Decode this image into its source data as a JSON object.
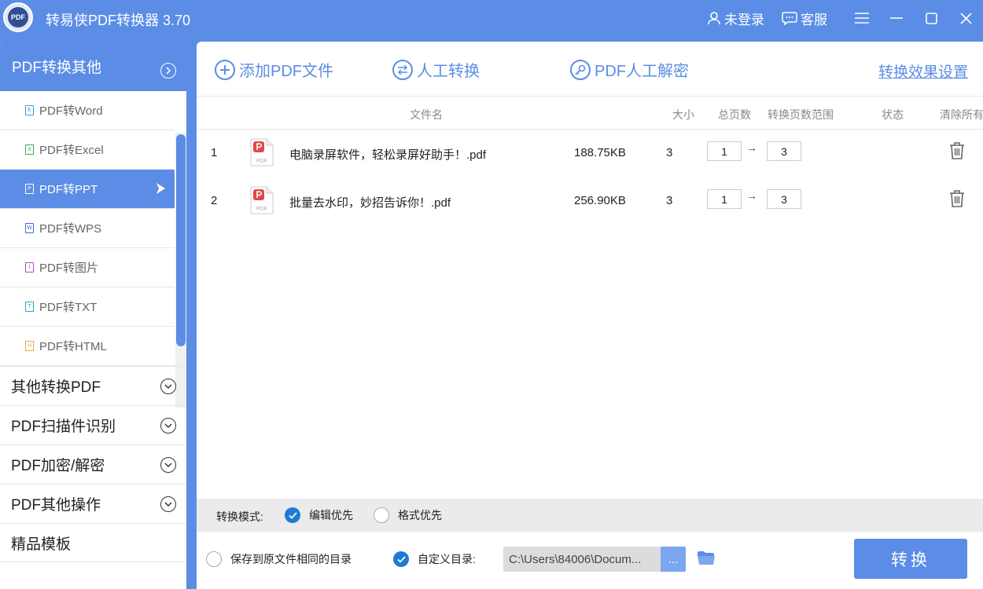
{
  "app": {
    "title": "转易侠PDF转换器 3.70",
    "logo_text": "PDF"
  },
  "titlebar": {
    "login_label": "未登录",
    "service_label": "客服"
  },
  "sidebar": {
    "header": "PDF转换其他",
    "sub_items": [
      {
        "label": "PDF转Word",
        "icon": "word-file-icon",
        "color": "#3a9ad9",
        "glyph": "E"
      },
      {
        "label": "PDF转Excel",
        "icon": "excel-file-icon",
        "color": "#3aa655",
        "glyph": "X"
      },
      {
        "label": "PDF转PPT",
        "icon": "ppt-file-icon",
        "color": "#ffffff",
        "glyph": "P"
      },
      {
        "label": "PDF转WPS",
        "icon": "wps-file-icon",
        "color": "#3a6fd9",
        "glyph": "W"
      },
      {
        "label": "PDF转图片",
        "icon": "image-file-icon",
        "color": "#b04ad0",
        "glyph": "I"
      },
      {
        "label": "PDF转TXT",
        "icon": "txt-file-icon",
        "color": "#2aa5c8",
        "glyph": "T"
      },
      {
        "label": "PDF转HTML",
        "icon": "html-file-icon",
        "color": "#e8a93a",
        "glyph": "H"
      }
    ],
    "active_index": 2,
    "groups": [
      "其他转换PDF",
      "PDF扫描件识别",
      "PDF加密/解密",
      "PDF其他操作"
    ],
    "template_label": "精品模板"
  },
  "toolbar": {
    "add_label": "添加PDF文件",
    "manual_label": "人工转换",
    "decrypt_label": "PDF人工解密",
    "settings_label": "转换效果设置"
  },
  "table": {
    "headers": {
      "name": "文件名",
      "size": "大小",
      "pages": "总页数",
      "range": "转换页数范围",
      "status": "状态",
      "clear": "清除所有"
    },
    "rows": [
      {
        "index": "1",
        "name": "电脑录屏软件，轻松录屏好助手！.pdf",
        "size": "188.75KB",
        "pages": "3",
        "from": "1",
        "to": "3"
      },
      {
        "index": "2",
        "name": "批量去水印，妙招告诉你！.pdf",
        "size": "256.90KB",
        "pages": "3",
        "from": "1",
        "to": "3"
      }
    ],
    "range_arrow": "→"
  },
  "mode": {
    "label": "转换模式:",
    "edit_first": "编辑优先",
    "format_first": "格式优先",
    "selected": "edit_first"
  },
  "output": {
    "same_dir_label": "保存到原文件相同的目录",
    "custom_dir_label": "自定义目录:",
    "dir_value": "C:\\Users\\84006\\Docum...",
    "browse_label": "...",
    "selected": "custom"
  },
  "convert_label": "转换",
  "colors": {
    "accent": "#5b8de6",
    "check": "#1f7ad6",
    "pdf_red": "#e04848"
  }
}
